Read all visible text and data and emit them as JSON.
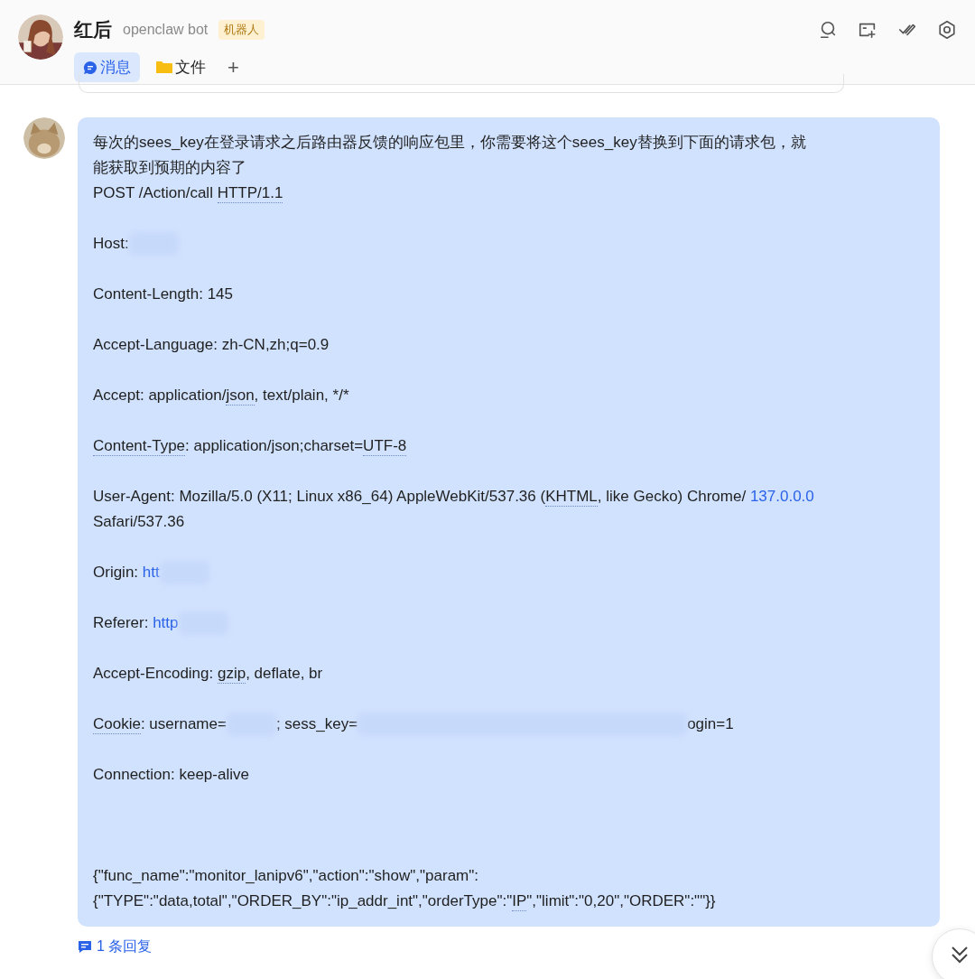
{
  "header": {
    "name": "红后",
    "subtitle": "openclaw bot",
    "badge": "机器人"
  },
  "tabs": [
    {
      "label": "消息",
      "selected": true
    },
    {
      "label": "文件",
      "selected": false
    }
  ],
  "add_tab": "+",
  "message": {
    "blocks": [
      {
        "kind": "lead",
        "lines": [
          [
            {
              "kind": "plain",
              "text": "每次的sees_key在登录请求之后路由器反馈的响应包里，你需要将这个sees_key替换到下面的请求包，就"
            }
          ],
          [
            {
              "kind": "plain",
              "text": "能获取到预期的内容了"
            }
          ],
          [
            {
              "kind": "plain",
              "text": "POST /Action/call "
            },
            {
              "kind": "dotted",
              "text": "HTTP/1.1"
            }
          ]
        ]
      },
      {
        "kind": "gap",
        "lines": [
          [
            {
              "kind": "plain",
              "text": "Host:"
            },
            {
              "kind": "redacted"
            }
          ]
        ]
      },
      {
        "kind": "gap",
        "lines": [
          [
            {
              "kind": "plain",
              "text": "Content-Length: 145"
            }
          ]
        ]
      },
      {
        "kind": "gap",
        "lines": [
          [
            {
              "kind": "plain",
              "text": "Accept-Language: zh-CN,zh;q=0.9"
            }
          ]
        ]
      },
      {
        "kind": "gap",
        "lines": [
          [
            {
              "kind": "plain",
              "text": "Accept: application/"
            },
            {
              "kind": "dotted",
              "text": "json"
            },
            {
              "kind": "plain",
              "text": ", text/plain, */*"
            }
          ]
        ]
      },
      {
        "kind": "gap",
        "lines": [
          [
            {
              "kind": "dotted",
              "text": "Content-Type"
            },
            {
              "kind": "plain",
              "text": ": application/json;charset="
            },
            {
              "kind": "dotted",
              "text": "UTF-8"
            }
          ]
        ]
      },
      {
        "kind": "gap",
        "lines": [
          [
            {
              "kind": "plain",
              "text": "User-Agent: Mozilla/5.0 (X11; Linux x86_64) AppleWebKit/537.36 ("
            },
            {
              "kind": "dotted",
              "text": "KHTML"
            },
            {
              "kind": "plain",
              "text": ", like Gecko) Chrome/ "
            },
            {
              "kind": "link",
              "text": "137.0.0.0"
            }
          ],
          [
            {
              "kind": "plain",
              "text": "Safari/537.36"
            }
          ]
        ]
      },
      {
        "kind": "gap",
        "lines": [
          [
            {
              "kind": "plain",
              "text": "Origin: "
            },
            {
              "kind": "link",
              "text": "htt"
            },
            {
              "kind": "redacted"
            }
          ]
        ]
      },
      {
        "kind": "gap",
        "lines": [
          [
            {
              "kind": "plain",
              "text": "Referer: "
            },
            {
              "kind": "link",
              "text": "http"
            },
            {
              "kind": "redacted"
            }
          ]
        ]
      },
      {
        "kind": "gap",
        "lines": [
          [
            {
              "kind": "plain",
              "text": "Accept-Encoding: "
            },
            {
              "kind": "dotted",
              "text": "gzip"
            },
            {
              "kind": "plain",
              "text": ", deflate, br"
            }
          ]
        ]
      },
      {
        "kind": "gap",
        "lines": [
          [
            {
              "kind": "dotted",
              "text": "Cookie"
            },
            {
              "kind": "plain",
              "text": ": username="
            },
            {
              "kind": "redacted"
            },
            {
              "kind": "plain",
              "text": "; sess_key="
            },
            {
              "kind": "redacted-long"
            },
            {
              "kind": "plain",
              "text": "ogin=1"
            }
          ]
        ]
      },
      {
        "kind": "gap",
        "lines": [
          [
            {
              "kind": "plain",
              "text": "Connection: keep-alive"
            }
          ]
        ]
      },
      {
        "kind": "far",
        "lines": [
          [
            {
              "kind": "plain",
              "text": "{\"func_name\":\"monitor_lanipv6\",\"action\":\"show\",\"param\":"
            }
          ],
          [
            {
              "kind": "plain",
              "text": "{\"TYPE\":\"data,total\",\"ORDER_BY\":\"ip_addr_int\",\"orderType\":\""
            },
            {
              "kind": "dotted",
              "text": "IP"
            },
            {
              "kind": "plain",
              "text": "\",\"limit\":\"0,20\",\"ORDER\":\"\"}}"
            }
          ]
        ]
      }
    ],
    "replies": "1 条回复"
  }
}
